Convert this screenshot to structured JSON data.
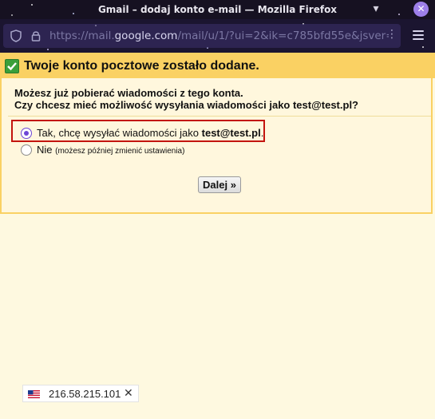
{
  "window": {
    "title": "Gmail – dodaj konto e-mail — Mozilla Firefox",
    "minimize_glyph": "▾",
    "close_glyph": "✕"
  },
  "urlbar": {
    "url_prefix": "https://mail.",
    "url_domain": "google.com",
    "url_suffix": "/mail/u/1/?ui=2&ik=c785bfd55e&jsver=1",
    "more_glyph": "⋮"
  },
  "dialog": {
    "header_title": "Twoje konto pocztowe zostało dodane.",
    "question_line1": "Możesz już pobierać wiadomości z tego konta.",
    "question_line2": "Czy chcesz mieć możliwość wysyłania wiadomości jako test@test.pl?",
    "option_yes_prefix": "Tak, chcę wysyłać wiadomości jako ",
    "option_yes_email": "test@test.pl",
    "option_yes_suffix": ".",
    "option_no_label": "Nie",
    "option_no_note": "(możesz później zmienić ustawienia)",
    "selected_option": "yes",
    "next_button": "Dalej »"
  },
  "ip_badge": {
    "ip": "216.58.215.101",
    "close_glyph": "✕"
  },
  "colors": {
    "header_bg": "#fad163",
    "panel_bg": "#fff7dd",
    "highlight_border": "#c3140e",
    "radio_accent": "#6e47d6"
  }
}
